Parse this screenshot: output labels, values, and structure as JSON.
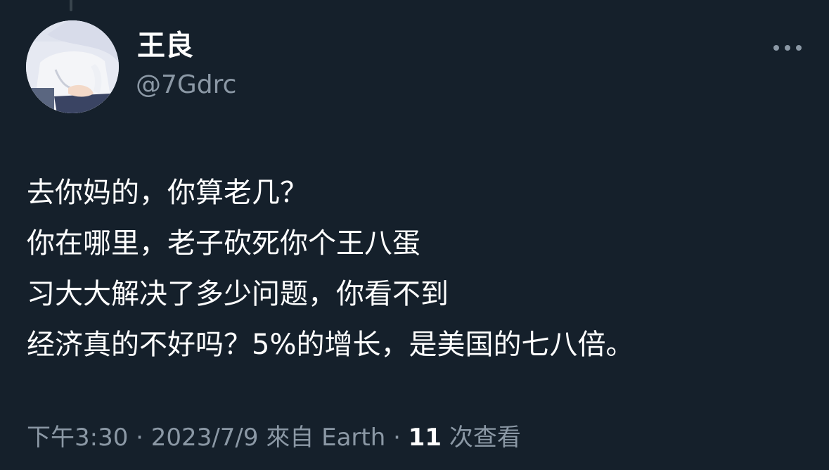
{
  "author": {
    "display_name": "王良",
    "handle": "@7Gdrc"
  },
  "tweet": {
    "lines": [
      "去你妈的，你算老几？",
      "你在哪里，老子砍死你个王八蛋",
      "习大大解决了多少问题，你看不到",
      "经济真的不好吗？5%的增长，是美国的七八倍。"
    ]
  },
  "meta": {
    "time": "下午3:30",
    "separator": " · ",
    "date": "2023/7/9",
    "source": "來自 Earth",
    "views_count": "11",
    "views_label": " 次查看"
  },
  "icons": {
    "more": "more-horizontal-icon"
  },
  "colors": {
    "background": "#15202b",
    "primary_text": "#ffffff",
    "secondary_text": "#8b98a5",
    "thread_line": "#38444d"
  }
}
